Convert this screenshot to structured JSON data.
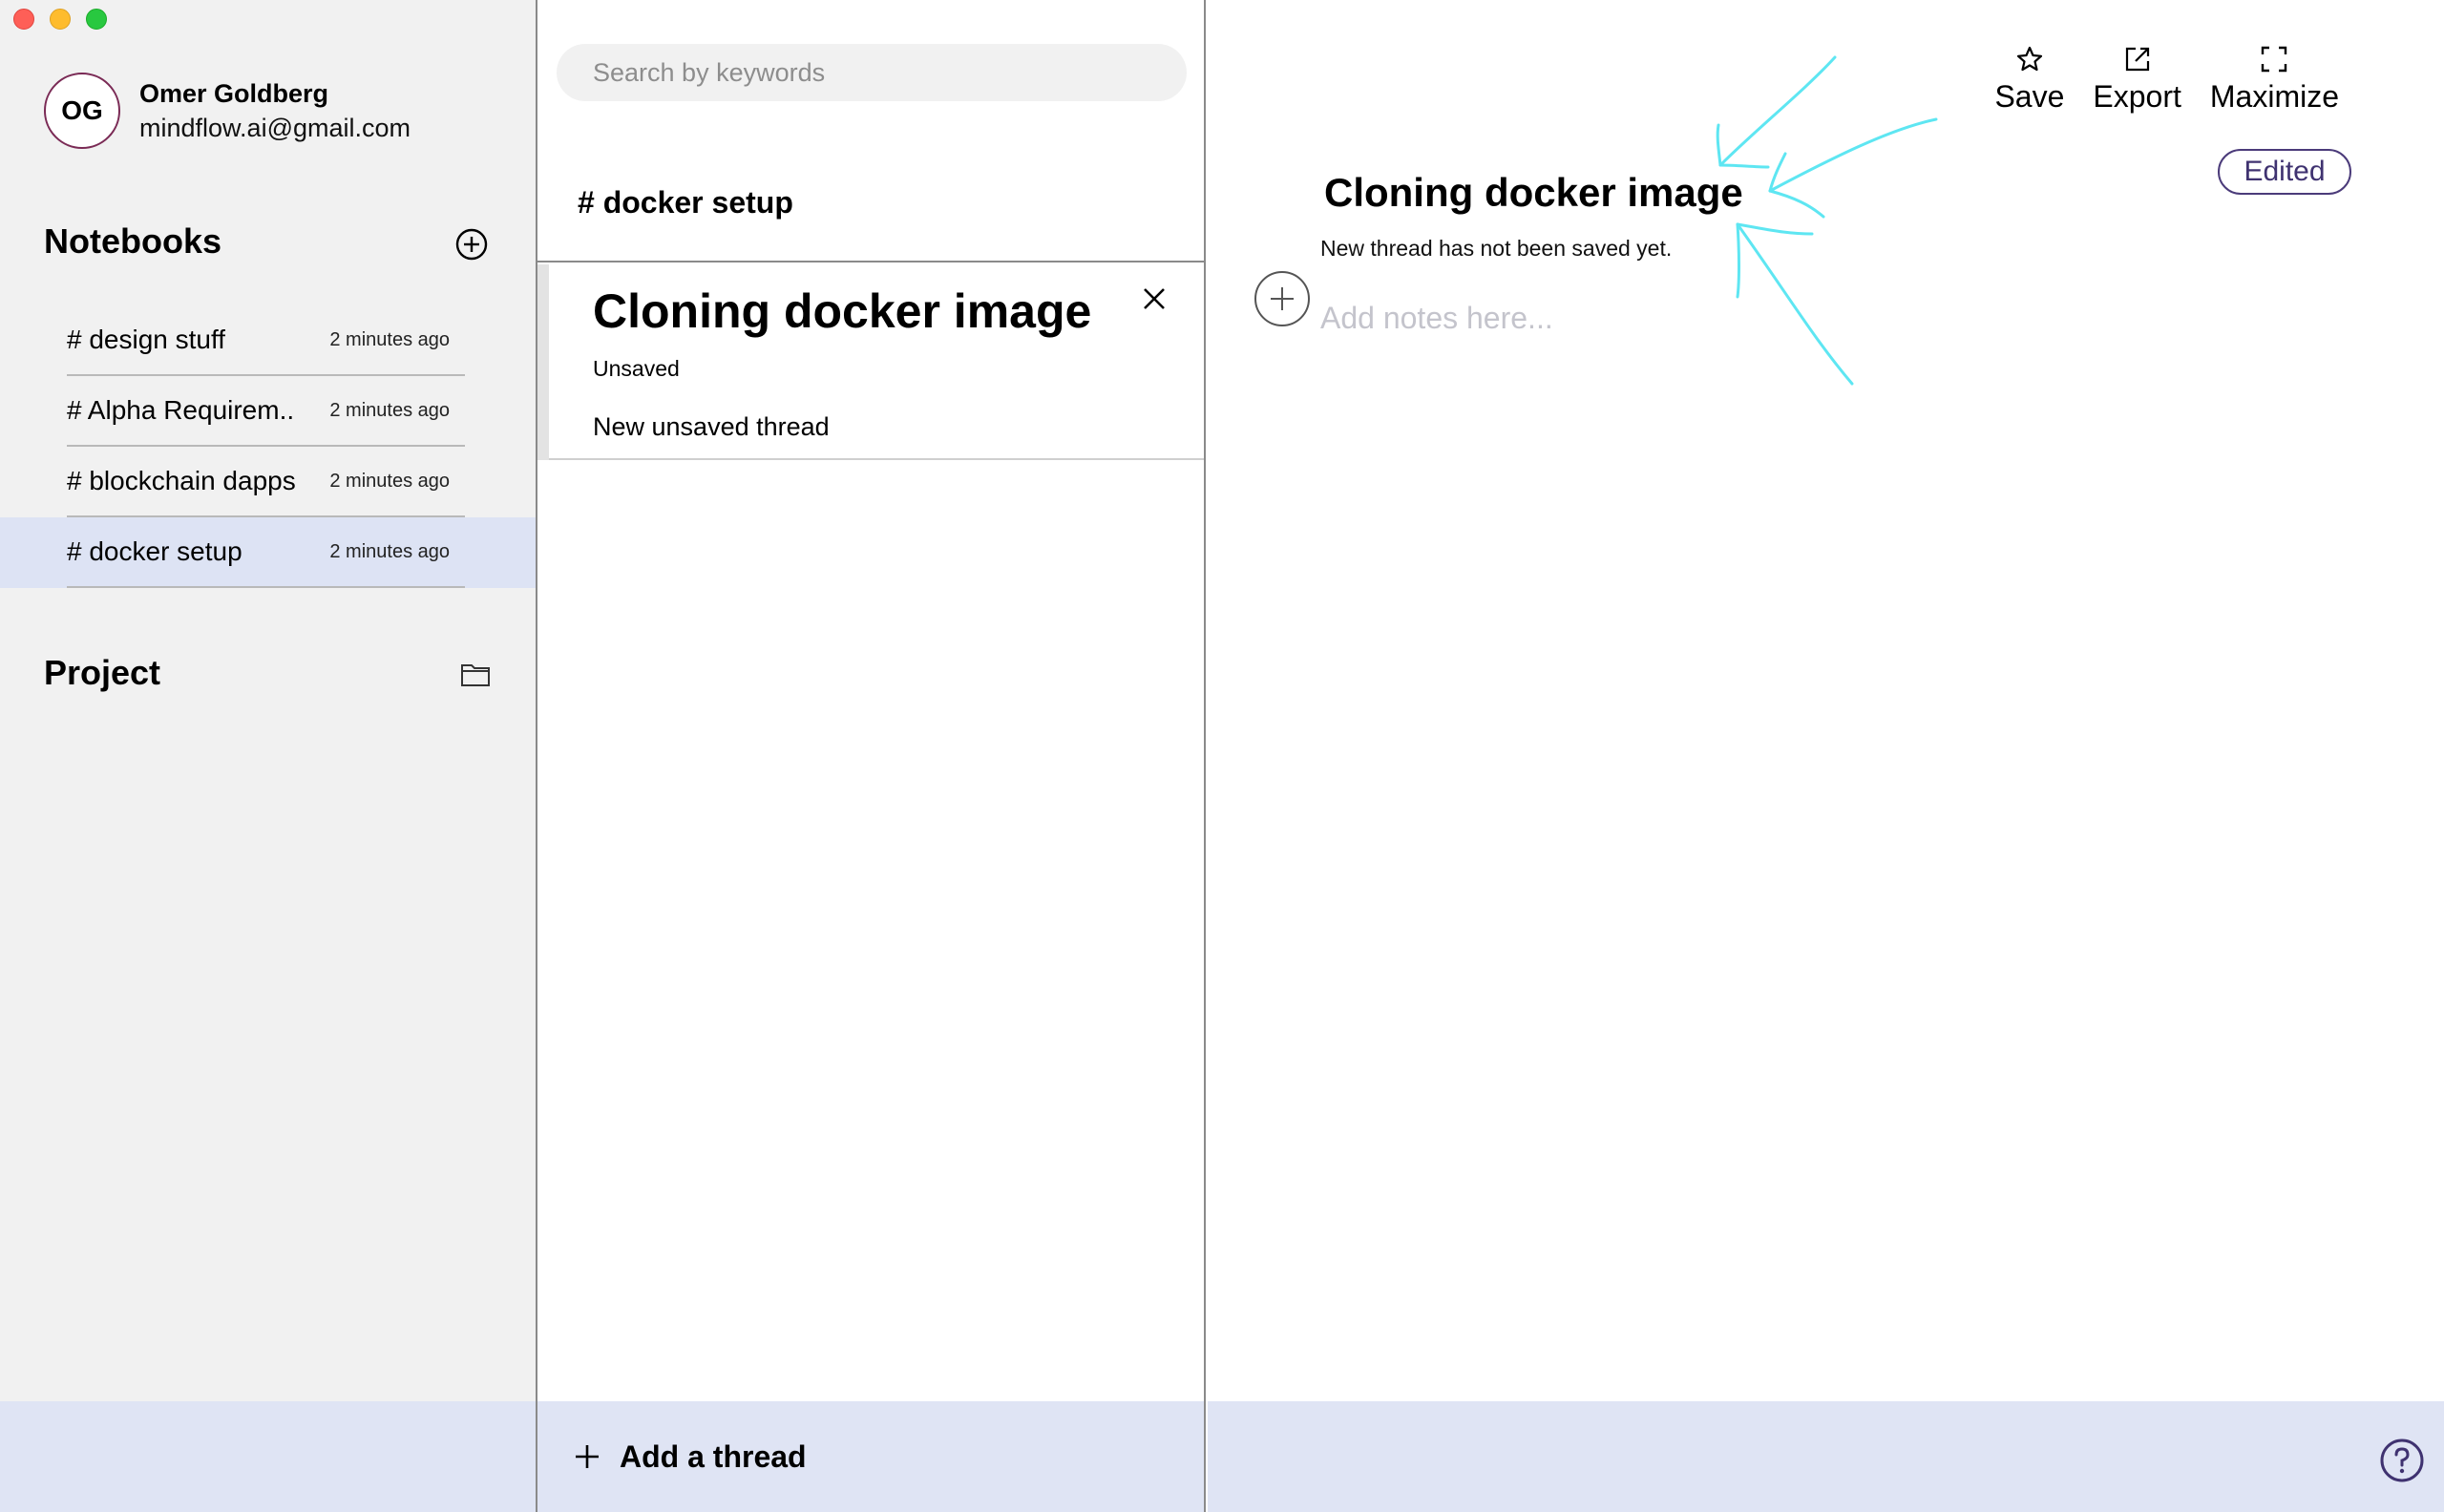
{
  "user": {
    "initials": "OG",
    "name": "Omer Goldberg",
    "email": "mindflow.ai@gmail.com"
  },
  "sidebar": {
    "notebooks_heading": "Notebooks",
    "notebooks": [
      {
        "label": "# design stuff",
        "time": "2 minutes ago",
        "active": false
      },
      {
        "label": "# Alpha Requirem..",
        "time": "2 minutes ago",
        "active": false
      },
      {
        "label": "# blockchain dapps",
        "time": "2 minutes ago",
        "active": false
      },
      {
        "label": "# docker setup",
        "time": "2 minutes ago",
        "active": true
      }
    ],
    "project_heading": "Project"
  },
  "middle": {
    "search_placeholder": "Search by keywords",
    "notebook_title": "# docker setup",
    "thread": {
      "title": "Cloning docker image",
      "status": "Unsaved",
      "description": "New unsaved thread"
    },
    "add_thread_label": "Add a thread"
  },
  "editor": {
    "toolbar": {
      "save": "Save",
      "export": "Export",
      "maximize": "Maximize"
    },
    "badge": "Edited",
    "title": "Cloning docker image",
    "subtitle": "New thread has not been saved yet.",
    "notes_placeholder": "Add notes here..."
  },
  "colors": {
    "accent": "#4b3b7a",
    "active_row": "#dde3f4",
    "bottom_bar": "#dfe4f4",
    "annotation": "#5ee6f2"
  }
}
